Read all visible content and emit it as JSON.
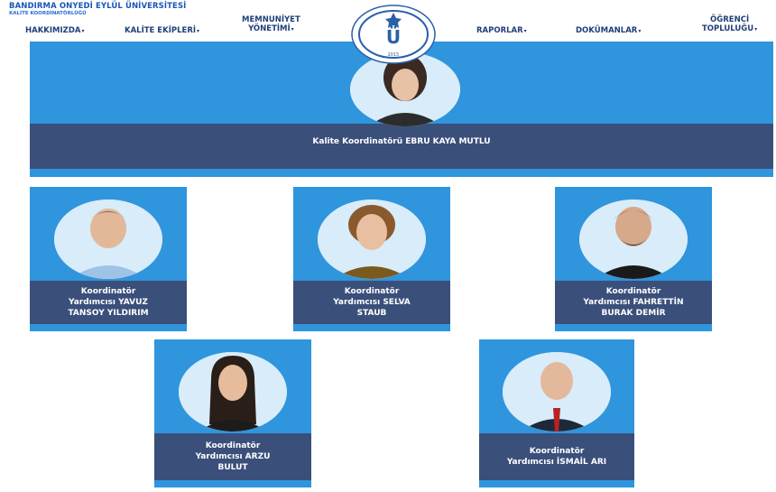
{
  "header": {
    "brand_title": "BANDIRMA ONYEDİ EYLÜL ÜNİVERSİTESİ",
    "brand_subtitle": "KALİTE KOORDİNATÖRLÜĞÜ",
    "nav": [
      {
        "line1": "HAKKIMIZDA",
        "line2": ""
      },
      {
        "line1": "KALİTE EKİPLERİ",
        "line2": ""
      },
      {
        "line1": "MEMNUNİYET",
        "line2": "YÖNETİMİ"
      },
      {
        "line1": "RAPORLAR",
        "line2": ""
      },
      {
        "line1": "DOKÜMANLAR",
        "line2": ""
      },
      {
        "line1": "ÖĞRENCİ",
        "line2": "TOPLULUĞU"
      }
    ],
    "logo_text": "BANDIRMA ONYEDİ EYLÜL ÜNİVERSİTESİ",
    "logo_year": "2015"
  },
  "coordinator": {
    "label": "Kalite Koordinatörü EBRU KAYA MUTLU"
  },
  "assistants": [
    {
      "lines": [
        "Koordinatör",
        "Yardımcısı YAVUZ",
        "TANSOY YILDIRIM"
      ]
    },
    {
      "lines": [
        "Koordinatör",
        "Yardımcısı SELVA",
        "STAUB"
      ]
    },
    {
      "lines": [
        "Koordinatör",
        "Yardımcısı FAHRETTİN",
        "BURAK DEMİR"
      ]
    },
    {
      "lines": [
        "Koordinatör",
        "Yardımcısı ARZU",
        "BULUT"
      ]
    },
    {
      "lines": [
        "Koordinatör",
        "Yardımcısı İSMAİL ARI"
      ]
    }
  ],
  "colors": {
    "card_blue": "#2f95dd",
    "label_navy": "#3a4f7a",
    "nav_text": "#1f3f7a",
    "brand_blue": "#1a56b8"
  }
}
